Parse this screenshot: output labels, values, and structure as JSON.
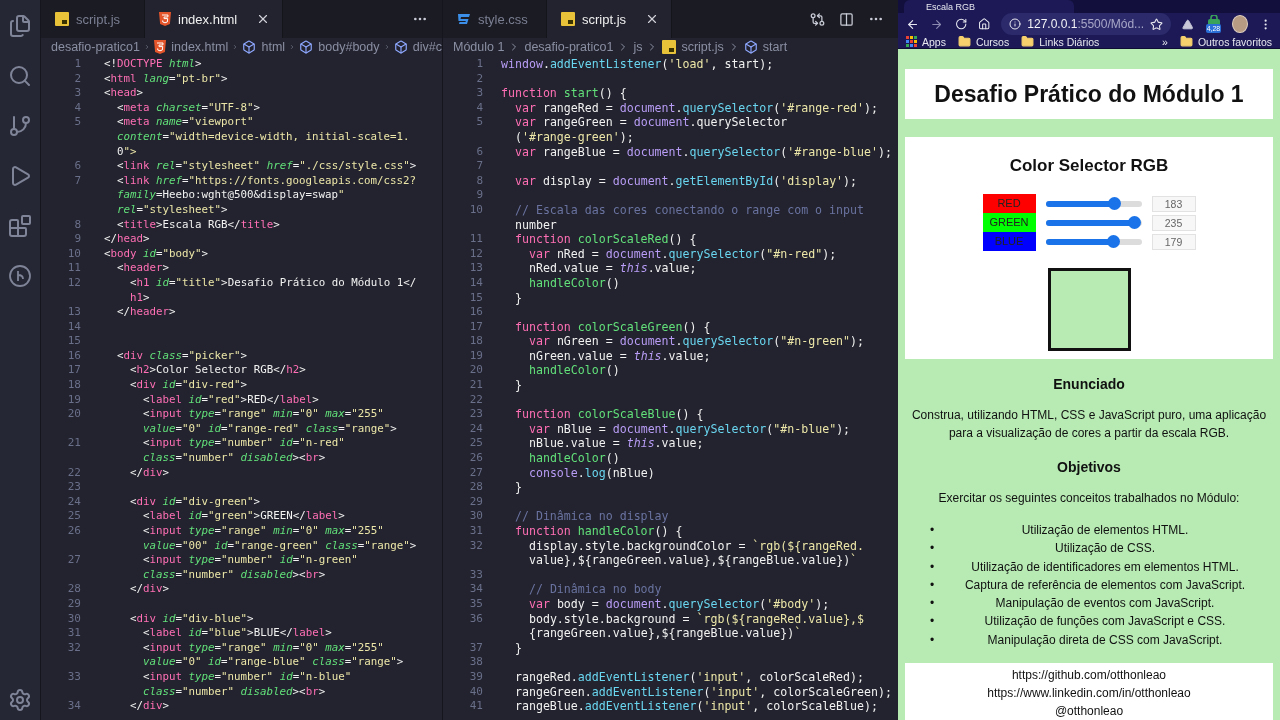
{
  "editors": [
    {
      "kind": "html",
      "tabs": [
        {
          "label": "script.js",
          "kind": "js",
          "selected": false
        },
        {
          "label": "index.html",
          "kind": "html",
          "selected": true
        }
      ],
      "breadcrumbs": [
        {
          "kind": "folder",
          "label": "desafio-pratico1"
        },
        {
          "kind": "html",
          "label": "index.html"
        },
        {
          "kind": "symbol",
          "label": "html"
        },
        {
          "kind": "symbol",
          "label": "body#body"
        },
        {
          "kind": "symbol",
          "label": "div#c"
        }
      ],
      "lines": [
        {
          "number": "1",
          "text": "<!DOCTYPE html>"
        },
        {
          "number": "2",
          "text": "<html lang=\"pt-br\">"
        },
        {
          "number": "3",
          "text": "<head>"
        },
        {
          "number": "4",
          "text": "  <meta charset=\"UTF-8\">"
        },
        {
          "number": "5",
          "text": "  <meta name=\"viewport\""
        },
        {
          "text": "  content=\"width=device-width, initial-scale=1."
        },
        {
          "text": "  0\">"
        },
        {
          "number": "6",
          "text": "  <link rel=\"stylesheet\" href=\"./css/style.css\">"
        },
        {
          "number": "7",
          "text": "  <link href=\"https://fonts.googleapis.com/css2?"
        },
        {
          "text": "  family=Heebo:wght@500&display=swap\""
        },
        {
          "text": "  rel=\"stylesheet\">"
        },
        {
          "number": "8",
          "text": "  <title>Escala RGB</title>"
        },
        {
          "number": "9",
          "text": "</head>"
        },
        {
          "number": "10",
          "text": "<body id=\"body\">"
        },
        {
          "number": "11",
          "text": "  <header>"
        },
        {
          "number": "12",
          "text": "    <h1 id=\"title\">Desafio Prático do Módulo 1</"
        },
        {
          "text": "    h1>"
        },
        {
          "number": "13",
          "text": "  </header>"
        },
        {
          "number": "14"
        },
        {
          "number": "15"
        },
        {
          "number": "16",
          "text": "  <div class=\"picker\">"
        },
        {
          "number": "17",
          "text": "    <h2>Color Selector RGB</h2>"
        },
        {
          "number": "18",
          "text": "    <div id=\"div-red\">"
        },
        {
          "number": "19",
          "text": "      <label id=\"red\">RED</label>"
        },
        {
          "number": "20",
          "text": "      <input type=\"range\" min=\"0\" max=\"255\""
        },
        {
          "text": "      value=\"0\" id=\"range-red\" class=\"range\">"
        },
        {
          "number": "21",
          "text": "      <input type=\"number\" id=\"n-red\""
        },
        {
          "text": "      class=\"number\" disabled><br>"
        },
        {
          "number": "22",
          "text": "    </div>"
        },
        {
          "number": "23"
        },
        {
          "number": "24",
          "text": "    <div id=\"div-green\">"
        },
        {
          "number": "25",
          "text": "      <label id=\"green\">GREEN</label>"
        },
        {
          "number": "26",
          "text": "      <input type=\"range\" min=\"0\" max=\"255\""
        },
        {
          "text": "      value=\"00\" id=\"range-green\" class=\"range\">"
        },
        {
          "number": "27",
          "text": "      <input type=\"number\" id=\"n-green\""
        },
        {
          "text": "      class=\"number\" disabled><br>"
        },
        {
          "number": "28",
          "text": "    </div>"
        },
        {
          "number": "29"
        },
        {
          "number": "30",
          "text": "    <div id=\"div-blue\">"
        },
        {
          "number": "31",
          "text": "      <label id=\"blue\">BLUE</label>"
        },
        {
          "number": "32",
          "text": "      <input type=\"range\" min=\"0\" max=\"255\""
        },
        {
          "text": "      value=\"0\" id=\"range-blue\" class=\"range\">"
        },
        {
          "number": "33",
          "text": "      <input type=\"number\" id=\"n-blue\""
        },
        {
          "text": "      class=\"number\" disabled><br>"
        },
        {
          "number": "34",
          "text": "    </div>"
        }
      ]
    },
    {
      "kind": "js",
      "tabs": [
        {
          "label": "style.css",
          "kind": "css",
          "selected": false
        },
        {
          "label": "script.js",
          "kind": "js",
          "selected": true
        }
      ],
      "breadcrumbs": [
        {
          "kind": "folder",
          "label": "Módulo 1"
        },
        {
          "kind": "folder",
          "label": "desafio-pratico1"
        },
        {
          "kind": "folder",
          "label": "js"
        },
        {
          "kind": "js",
          "label": "script.js"
        },
        {
          "kind": "symbol",
          "label": "start"
        }
      ],
      "lines": [
        {
          "number": "1",
          "text": "window.addEventListener('load', start);"
        },
        {
          "number": "2"
        },
        {
          "number": "3",
          "text": "function start() {"
        },
        {
          "number": "4",
          "text": "  var rangeRed = document.querySelector('#range-red');"
        },
        {
          "number": "5",
          "text": "  var rangeGreen = document.querySelector"
        },
        {
          "text": "  ('#range-green');"
        },
        {
          "number": "6",
          "text": "  var rangeBlue = document.querySelector('#range-blue');"
        },
        {
          "number": "7"
        },
        {
          "number": "8",
          "text": "  var display = document.getElementById('display');"
        },
        {
          "number": "9"
        },
        {
          "number": "10",
          "text": "  // Escala das cores conectando o range com o input"
        },
        {
          "text": "  number"
        },
        {
          "number": "11",
          "text": "  function colorScaleRed() {"
        },
        {
          "number": "12",
          "text": "    var nRed = document.querySelector(\"#n-red\");"
        },
        {
          "number": "13",
          "text": "    nRed.value = this.value;"
        },
        {
          "number": "14",
          "text": "    handleColor()"
        },
        {
          "number": "15",
          "text": "  }"
        },
        {
          "number": "16"
        },
        {
          "number": "17",
          "text": "  function colorScaleGreen() {"
        },
        {
          "number": "18",
          "text": "    var nGreen = document.querySelector(\"#n-green\");"
        },
        {
          "number": "19",
          "text": "    nGreen.value = this.value;"
        },
        {
          "number": "20",
          "text": "    handleColor()"
        },
        {
          "number": "21",
          "text": "  }"
        },
        {
          "number": "22"
        },
        {
          "number": "23",
          "text": "  function colorScaleBlue() {"
        },
        {
          "number": "24",
          "text": "    var nBlue = document.querySelector(\"#n-blue\");"
        },
        {
          "number": "25",
          "text": "    nBlue.value = this.value;"
        },
        {
          "number": "26",
          "text": "    handleColor()"
        },
        {
          "number": "27",
          "text": "    console.log(nBlue)"
        },
        {
          "number": "28",
          "text": "  }"
        },
        {
          "number": "29"
        },
        {
          "number": "30",
          "text": "  // Dinâmica no display"
        },
        {
          "number": "31",
          "text": "  function handleColor() {"
        },
        {
          "number": "32",
          "text": "    display.style.backgroundColor = `rgb(${rangeRed."
        },
        {
          "text": "    value},${rangeGreen.value},${rangeBlue.value})`"
        },
        {
          "number": "33"
        },
        {
          "number": "34",
          "text": "    // Dinâmica no body"
        },
        {
          "number": "35",
          "text": "    var body = document.querySelector('#body');"
        },
        {
          "number": "36",
          "text": "    body.style.background = `rgb(${rangeRed.value},$"
        },
        {
          "text": "    {rangeGreen.value},${rangeBlue.value})`"
        },
        {
          "number": "37",
          "text": "  }"
        },
        {
          "number": "38"
        },
        {
          "number": "39",
          "text": "  rangeRed.addEventListener('input', colorScaleRed);"
        },
        {
          "number": "40",
          "text": "  rangeGreen.addEventListener('input', colorScaleGreen);"
        },
        {
          "number": "41",
          "text": "  rangeBlue.addEventListener('input', colorScaleBlue);"
        }
      ]
    }
  ],
  "browser": {
    "tab_title": "Escala RGB",
    "url": {
      "host": "127.0.0.1",
      "path": ":5500/Mód..."
    },
    "extension_badge": "4,28",
    "bookmarks": [
      {
        "kind": "apps",
        "label": "Apps"
      },
      {
        "kind": "folder",
        "label": "Cursos"
      },
      {
        "kind": "folder",
        "label": "Links Diários"
      },
      {
        "kind": "overflow",
        "label": "»"
      },
      {
        "kind": "folder",
        "label": "Outros favoritos"
      }
    ],
    "page": {
      "title": "Desafio Prático do Módulo 1",
      "picker": {
        "heading": "Color Selector RGB",
        "channels": [
          {
            "label": "RED",
            "color": "#ff0000",
            "level": 0.718,
            "value": "183"
          },
          {
            "label": "GREEN",
            "color": "#00ff00",
            "level": 0.922,
            "value": "235"
          },
          {
            "label": "BLUE",
            "color": "#0000ff",
            "level": 0.702,
            "value": "179"
          }
        ]
      },
      "statement": {
        "heading": "Enunciado",
        "text": "Construa, utilizando HTML, CSS e JavaScript puro, uma aplicação para a visualização de cores a partir da escala RGB."
      },
      "goals": {
        "heading": "Objetivos",
        "intro": "Exercitar os seguintes conceitos trabalhados no Módulo:",
        "items": [
          {
            "marker": "•",
            "text": "Utilização de elementos HTML."
          },
          {
            "marker": "•",
            "text": "Utilização de CSS."
          },
          {
            "marker": "•",
            "text": "Utilização de identificadores em elementos HTML."
          },
          {
            "marker": "•",
            "text": "Captura de referência de elementos com JavaScript."
          },
          {
            "marker": "•",
            "text": "Manipulação de eventos com JavaScript."
          },
          {
            "marker": "•",
            "text": "Utilização de funções com JavaScript e CSS."
          },
          {
            "marker": "•",
            "text": "Manipulação direta de CSS com JavaScript."
          }
        ]
      },
      "footer": [
        "https://github.com/otthonleao",
        "https://www.linkedin.com/in/otthonleao",
        "@otthonleao"
      ]
    }
  }
}
